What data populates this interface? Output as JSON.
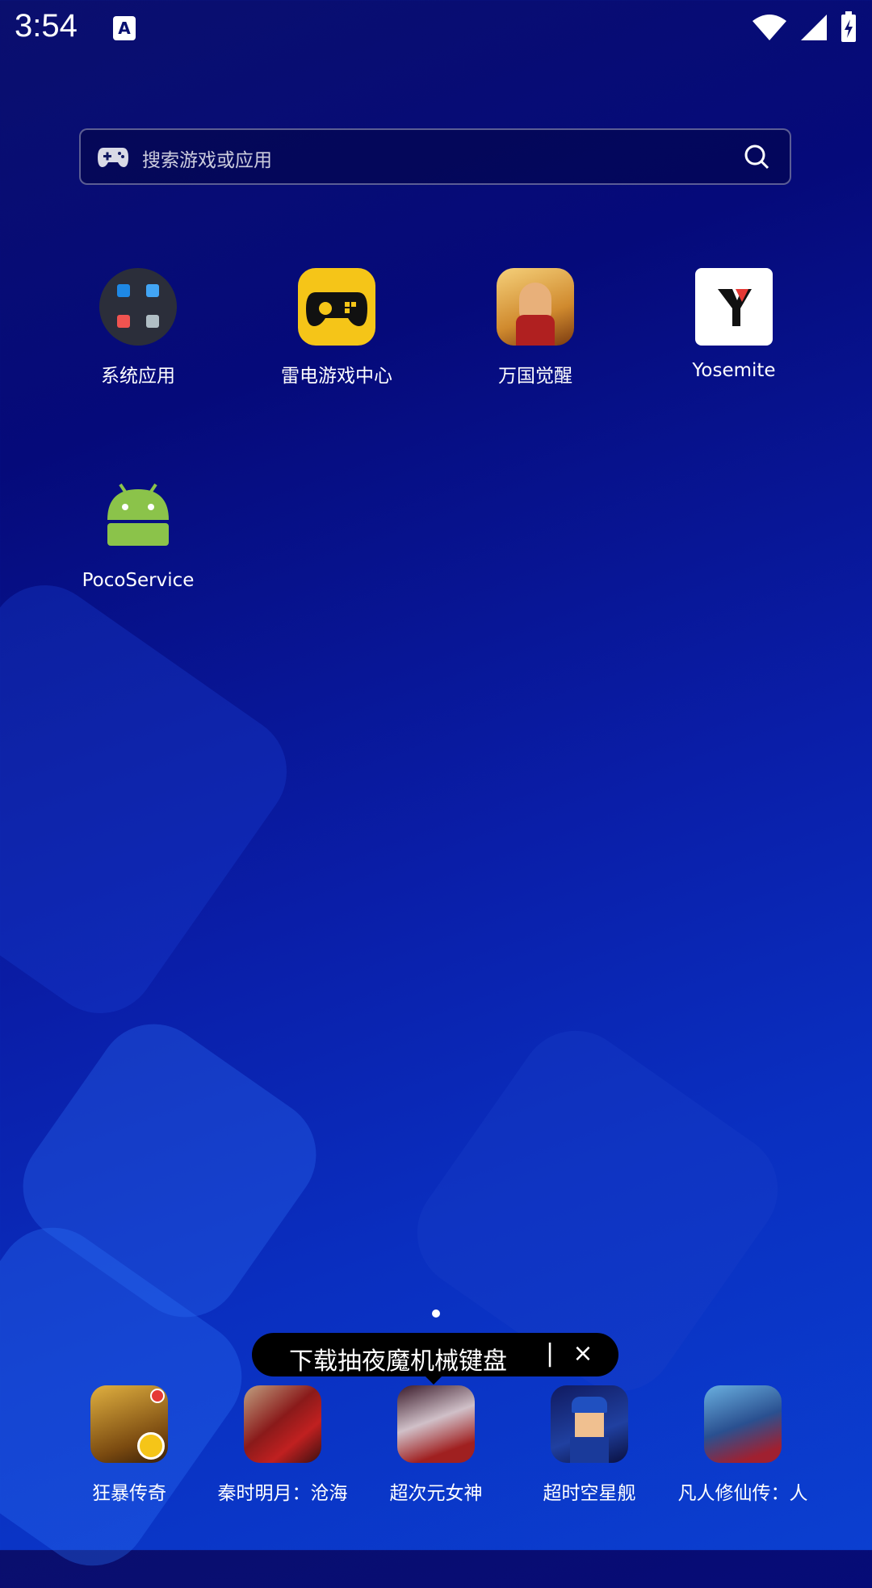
{
  "status_bar": {
    "time": "3:54",
    "notification_icon": "A",
    "icons": [
      "wifi-icon",
      "signal-icon",
      "battery-charging-icon"
    ]
  },
  "search": {
    "placeholder": "搜索游戏或应用",
    "left_icon": "gamepad-icon",
    "right_icon": "search-icon"
  },
  "apps": [
    {
      "label": "系统应用",
      "icon": "folder-icon"
    },
    {
      "label": "雷电游戏中心",
      "icon": "ldplayer-gamecenter-icon"
    },
    {
      "label": "万国觉醒",
      "icon": "rise-of-kingdoms-icon"
    },
    {
      "label": "Yosemite",
      "icon": "yosemite-icon"
    },
    {
      "label": "PocoService",
      "icon": "android-icon"
    }
  ],
  "tooltip": {
    "text": "下载抽夜魔机械键盘",
    "separator": "|",
    "close": "×"
  },
  "dock": [
    {
      "label": "狂暴传奇",
      "icon": "game-kuangbao-icon"
    },
    {
      "label": "秦时明月：沧海",
      "icon": "game-qinshi-icon"
    },
    {
      "label": "超次元女神",
      "icon": "game-chaociyuan-icon"
    },
    {
      "label": "超时空星舰",
      "icon": "game-chaoshikong-icon"
    },
    {
      "label": "凡人修仙传：人",
      "icon": "game-fanren-icon"
    }
  ],
  "colors": {
    "accent_yellow": "#f5c518",
    "android_green": "#8bc34a"
  }
}
